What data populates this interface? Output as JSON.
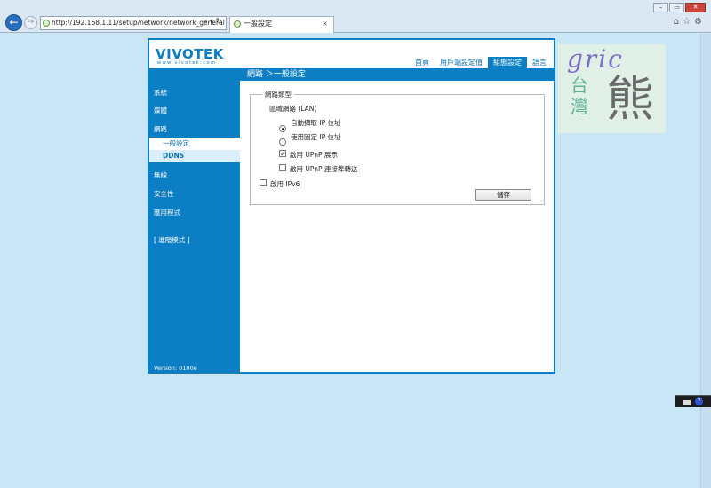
{
  "browser": {
    "url": "http://192.168.1.11/setup/network/network_general",
    "tab_title": "一般設定",
    "tab_close": "×",
    "address_tools": "⌕ ▾ ↻",
    "back_glyph": "←",
    "forward_glyph": "→",
    "window_controls": {
      "minimize": "–",
      "maximize": "▭",
      "close": "✕"
    },
    "right_icons": "⌂☆⚙"
  },
  "app": {
    "logo": "VIVOTEK",
    "logo_sub": "www.vivotek.com",
    "top_nav": [
      {
        "label": "首頁",
        "active": false
      },
      {
        "label": "用戶端設定值",
        "active": false
      },
      {
        "label": "組態設定",
        "active": true
      },
      {
        "label": "語言",
        "active": false
      }
    ],
    "page_heading": "網路 ＞一般設定",
    "sidebar": {
      "items": [
        {
          "label": "系統"
        },
        {
          "label": "媒體"
        },
        {
          "label": "網路"
        },
        {
          "label": "無線"
        },
        {
          "label": "安全性"
        },
        {
          "label": "應用程式"
        },
        {
          "label": "[ 進階模式 ]"
        }
      ],
      "sub_items": [
        {
          "label": "一般設定",
          "active": true
        },
        {
          "label": "DDNS",
          "active": false
        }
      ],
      "version": "Version: 0100e"
    },
    "network_type": {
      "legend": "網路類型",
      "lan_label": "區域網路 (LAN)",
      "auto_ip_label": "自動擷取 IP 位址",
      "static_ip_label": "使用固定 IP 位址",
      "upnp_label": "啟用 UPnP 展示",
      "upnp_forward_label": "啟用 UPnP 連接埠轉送",
      "ipv6_label": "啟用 IPv6",
      "save_label": "儲存",
      "auto_ip_selected": true,
      "static_ip_selected": false,
      "upnp_checked": true,
      "upnp_forward_checked": false,
      "ipv6_checked": false
    }
  },
  "watermark": {
    "text_latin": "gric",
    "text_tw": "台灣",
    "text_bear": "熊"
  },
  "colors": {
    "accent": "#0c7fc4",
    "page_bg": "#c9e6f6"
  }
}
